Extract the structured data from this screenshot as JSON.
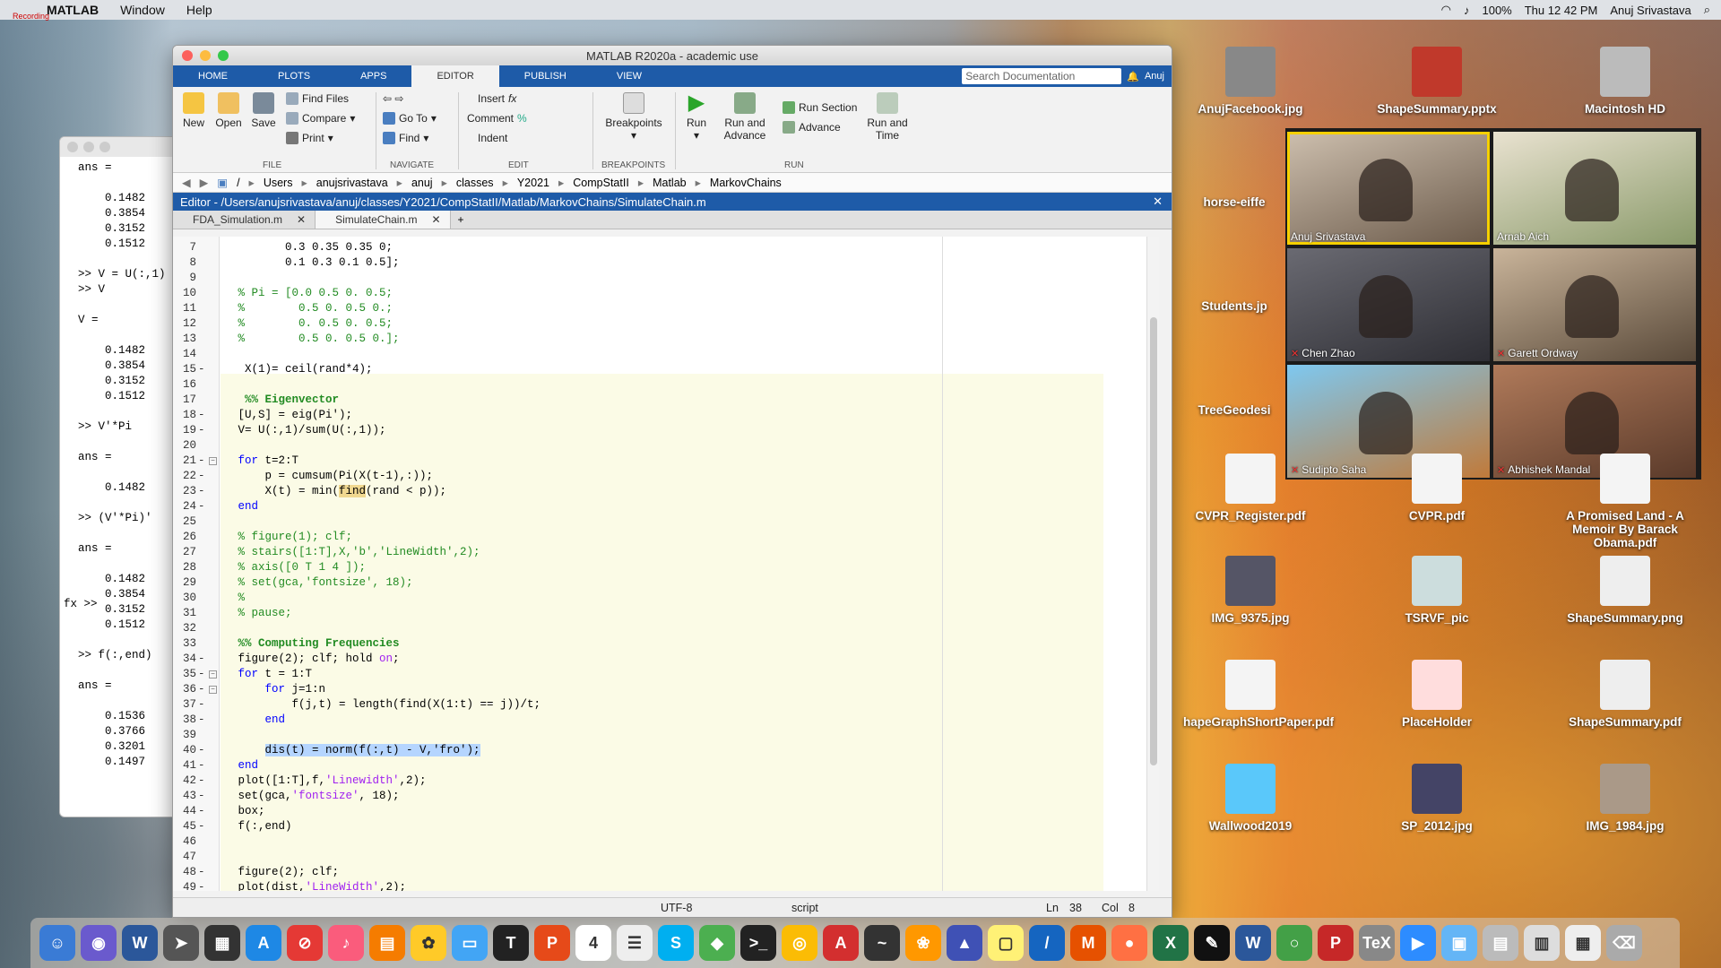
{
  "menubar": {
    "app": "MATLAB",
    "items": [
      "Window",
      "Help"
    ],
    "battery": "100%",
    "clock": "Thu 12 42 PM",
    "user": "Anuj  Srivastava",
    "recording": "Recording"
  },
  "cmd": {
    "lines": [
      "ans =",
      "",
      "    0.1482",
      "    0.3854",
      "    0.3152",
      "    0.1512",
      "",
      ">> V = U(:,1)",
      ">> V",
      "",
      "V =",
      "",
      "    0.1482",
      "    0.3854",
      "    0.3152",
      "    0.1512",
      "",
      ">> V'*Pi",
      "",
      "ans =",
      "",
      "    0.1482",
      "",
      ">> (V'*Pi)'",
      "",
      "ans =",
      "",
      "    0.1482",
      "    0.3854",
      "    0.3152",
      "    0.1512",
      "",
      ">> f(:,end)",
      "",
      "ans =",
      "",
      "    0.1536",
      "    0.3766",
      "    0.3201",
      "    0.1497"
    ],
    "prompt": "fx >>"
  },
  "window": {
    "title": "MATLAB R2020a - academic use"
  },
  "tabs": [
    "HOME",
    "PLOTS",
    "APPS",
    "EDITOR",
    "PUBLISH",
    "VIEW"
  ],
  "search": {
    "placeholder": "Search Documentation",
    "user": "Anuj"
  },
  "ribbon": {
    "new": "New",
    "open": "Open",
    "save": "Save",
    "find_files": "Find Files",
    "compare": "Compare",
    "print": "Print",
    "file": "FILE",
    "goto": "Go To",
    "find": "Find",
    "navigate": "NAVIGATE",
    "insert": "Insert",
    "comment": "Comment",
    "indent": "Indent",
    "edit": "EDIT",
    "breakpoints": "Breakpoints",
    "bp_group": "BREAKPOINTS",
    "run": "Run",
    "run_advance": "Run and Advance",
    "run_section": "Run Section",
    "advance": "Advance",
    "run_time": "Run and Time",
    "run_group": "RUN"
  },
  "path": [
    "/",
    "Users",
    "anujsrivastava",
    "anuj",
    "classes",
    "Y2021",
    "CompStatII",
    "Matlab",
    "MarkovChains"
  ],
  "editor": {
    "header": "Editor - /Users/anujsrivastava/anuj/classes/Y2021/CompStatII/Matlab/MarkovChains/SimulateChain.m",
    "files": [
      "FDA_Simulation.m",
      "SimulateChain.m"
    ]
  },
  "status": {
    "encoding": "UTF-8",
    "type": "script",
    "ln": "Ln",
    "ln_val": "38",
    "col": "Col",
    "col_val": "8"
  },
  "zoom": [
    {
      "name": "Anuj Srivastava",
      "active": true
    },
    {
      "name": "Arnab Aich",
      "active": false
    },
    {
      "name": "Chen Zhao",
      "active": false
    },
    {
      "name": "Garett Ordway",
      "active": false
    },
    {
      "name": "Sudipto Saha",
      "active": false
    },
    {
      "name": "Abhishek Mandal",
      "active": false
    }
  ],
  "desktop": [
    "AnujFacebook.jpg",
    "ShapeSummary.pptx",
    "Macintosh HD",
    "horse-eiffe",
    "Students.jp",
    "TreeGeodesi",
    "CVPR_Register.pdf",
    "CVPR.pdf",
    "A Promised Land - A Memoir By Barack Obama.pdf",
    "IMG_9375.jpg",
    "TSRVF_pic",
    "ShapeSummary.png",
    "hapeGraphShortPaper.pdf",
    "PlaceHolder",
    "ShapeSummary.pdf",
    "Wallwood2019",
    "SP_2012.jpg",
    "IMG_1984.jpg"
  ],
  "dock": [
    {
      "label": "☺",
      "color": "#3a7bd5"
    },
    {
      "label": "◉",
      "color": "#6a5acd"
    },
    {
      "label": "W",
      "color": "#2b579a"
    },
    {
      "label": "➤",
      "color": "#555"
    },
    {
      "label": "▦",
      "color": "#333"
    },
    {
      "label": "A",
      "color": "#1e88e5"
    },
    {
      "label": "⊘",
      "color": "#e53935"
    },
    {
      "label": "♪",
      "color": "#fa5c7c"
    },
    {
      "label": "▤",
      "color": "#f57c00"
    },
    {
      "label": "✿",
      "color": "#ffca28"
    },
    {
      "label": "▭",
      "color": "#42a5f5"
    },
    {
      "label": "T",
      "color": "#222"
    },
    {
      "label": "P",
      "color": "#e64a19"
    },
    {
      "label": "4",
      "color": "#fff"
    },
    {
      "label": "☰",
      "color": "#eee"
    },
    {
      "label": "S",
      "color": "#00aff0"
    },
    {
      "label": "◆",
      "color": "#4caf50"
    },
    {
      "label": ">_",
      "color": "#222"
    },
    {
      "label": "◎",
      "color": "#fbbc05"
    },
    {
      "label": "A",
      "color": "#d32f2f"
    },
    {
      "label": "~",
      "color": "#333"
    },
    {
      "label": "❀",
      "color": "#ff9800"
    },
    {
      "label": "▲",
      "color": "#3f51b5"
    },
    {
      "label": "▢",
      "color": "#fff176"
    },
    {
      "label": "/",
      "color": "#1565c0"
    },
    {
      "label": "M",
      "color": "#e65100"
    },
    {
      "label": "●",
      "color": "#ff7043"
    },
    {
      "label": "X",
      "color": "#217346"
    },
    {
      "label": "✎",
      "color": "#111"
    },
    {
      "label": "W",
      "color": "#2b579a"
    },
    {
      "label": "○",
      "color": "#43a047"
    },
    {
      "label": "P",
      "color": "#c62828"
    },
    {
      "label": "TeX",
      "color": "#888"
    },
    {
      "label": "▶",
      "color": "#2d8cff"
    },
    {
      "label": "▣",
      "color": "#64b5f6"
    },
    {
      "label": "▤",
      "color": "#bbb"
    },
    {
      "label": "▥",
      "color": "#ddd"
    },
    {
      "label": "▦",
      "color": "#eee"
    },
    {
      "label": "⌫",
      "color": "#aaa"
    }
  ],
  "code": [
    {
      "n": "7",
      "t": "        0.3 0.35 0.35 0;",
      "c": ""
    },
    {
      "n": "8",
      "t": "        0.1 0.3 0.1 0.5];",
      "c": ""
    },
    {
      "n": "9",
      "t": "",
      "c": ""
    },
    {
      "n": "10",
      "t": " % Pi = [0.0 0.5 0. 0.5;",
      "c": "cm"
    },
    {
      "n": "11",
      "t": " %        0.5 0. 0.5 0.;",
      "c": "cm"
    },
    {
      "n": "12",
      "t": " %        0. 0.5 0. 0.5;",
      "c": "cm"
    },
    {
      "n": "13",
      "t": " %        0.5 0. 0.5 0.];",
      "c": "cm"
    },
    {
      "n": "14",
      "t": "",
      "c": ""
    },
    {
      "n": "15",
      "t": "  X(1)= ceil(rand*4);",
      "c": ""
    },
    {
      "n": "16",
      "t": "",
      "c": ""
    },
    {
      "n": "17",
      "t": "  %% Eigenvector",
      "c": "cmb"
    },
    {
      "n": "18",
      "t": " [U,S] = eig(Pi');",
      "c": ""
    },
    {
      "n": "19",
      "t": " V= U(:,1)/sum(U(:,1));",
      "c": ""
    },
    {
      "n": "20",
      "t": "",
      "c": ""
    },
    {
      "n": "21",
      "t": " for t=2:T",
      "c": "kwl"
    },
    {
      "n": "22",
      "t": "     p = cumsum(Pi(X(t-1),:));",
      "c": ""
    },
    {
      "n": "23",
      "t": "     X(t) = min(find(rand < p));",
      "c": "find"
    },
    {
      "n": "24",
      "t": " end",
      "c": "kw"
    },
    {
      "n": "25",
      "t": "",
      "c": ""
    },
    {
      "n": "26",
      "t": " % figure(1); clf;",
      "c": "cm"
    },
    {
      "n": "27",
      "t": " % stairs([1:T],X,'b','LineWidth',2);",
      "c": "cm"
    },
    {
      "n": "28",
      "t": " % axis([0 T 1 4 ]);",
      "c": "cm"
    },
    {
      "n": "29",
      "t": " % set(gca,'fontsize', 18);",
      "c": "cm"
    },
    {
      "n": "30",
      "t": " %",
      "c": "cm"
    },
    {
      "n": "31",
      "t": " % pause;",
      "c": "cm"
    },
    {
      "n": "32",
      "t": "",
      "c": ""
    },
    {
      "n": "33",
      "t": " %% Computing Frequencies",
      "c": "cmb"
    },
    {
      "n": "34",
      "t": " figure(2); clf; hold on;",
      "c": "holdon"
    },
    {
      "n": "35",
      "t": " for t = 1:T",
      "c": "kwl"
    },
    {
      "n": "36",
      "t": "     for j=1:n",
      "c": "kwl2"
    },
    {
      "n": "37",
      "t": "         f(j,t) = length(find(X(1:t) == j))/t;",
      "c": ""
    },
    {
      "n": "38",
      "t": "     end",
      "c": "kw"
    },
    {
      "n": "39",
      "t": "",
      "c": ""
    },
    {
      "n": "40",
      "t": "     dis(t) = norm(f(:,t) - V,'fro');",
      "c": "sel"
    },
    {
      "n": "41",
      "t": " end",
      "c": "kw"
    },
    {
      "n": "42",
      "t": " plot([1:T],f,'Linewidth',2);",
      "c": "str"
    },
    {
      "n": "43",
      "t": " set(gca,'fontsize', 18);",
      "c": "str"
    },
    {
      "n": "44",
      "t": " box;",
      "c": ""
    },
    {
      "n": "45",
      "t": " f(:,end)",
      "c": ""
    },
    {
      "n": "46",
      "t": "",
      "c": ""
    },
    {
      "n": "47",
      "t": "",
      "c": ""
    },
    {
      "n": "48",
      "t": " figure(2); clf;",
      "c": ""
    },
    {
      "n": "49",
      "t": " plot(dist,'LineWidth',2);",
      "c": "str"
    }
  ]
}
